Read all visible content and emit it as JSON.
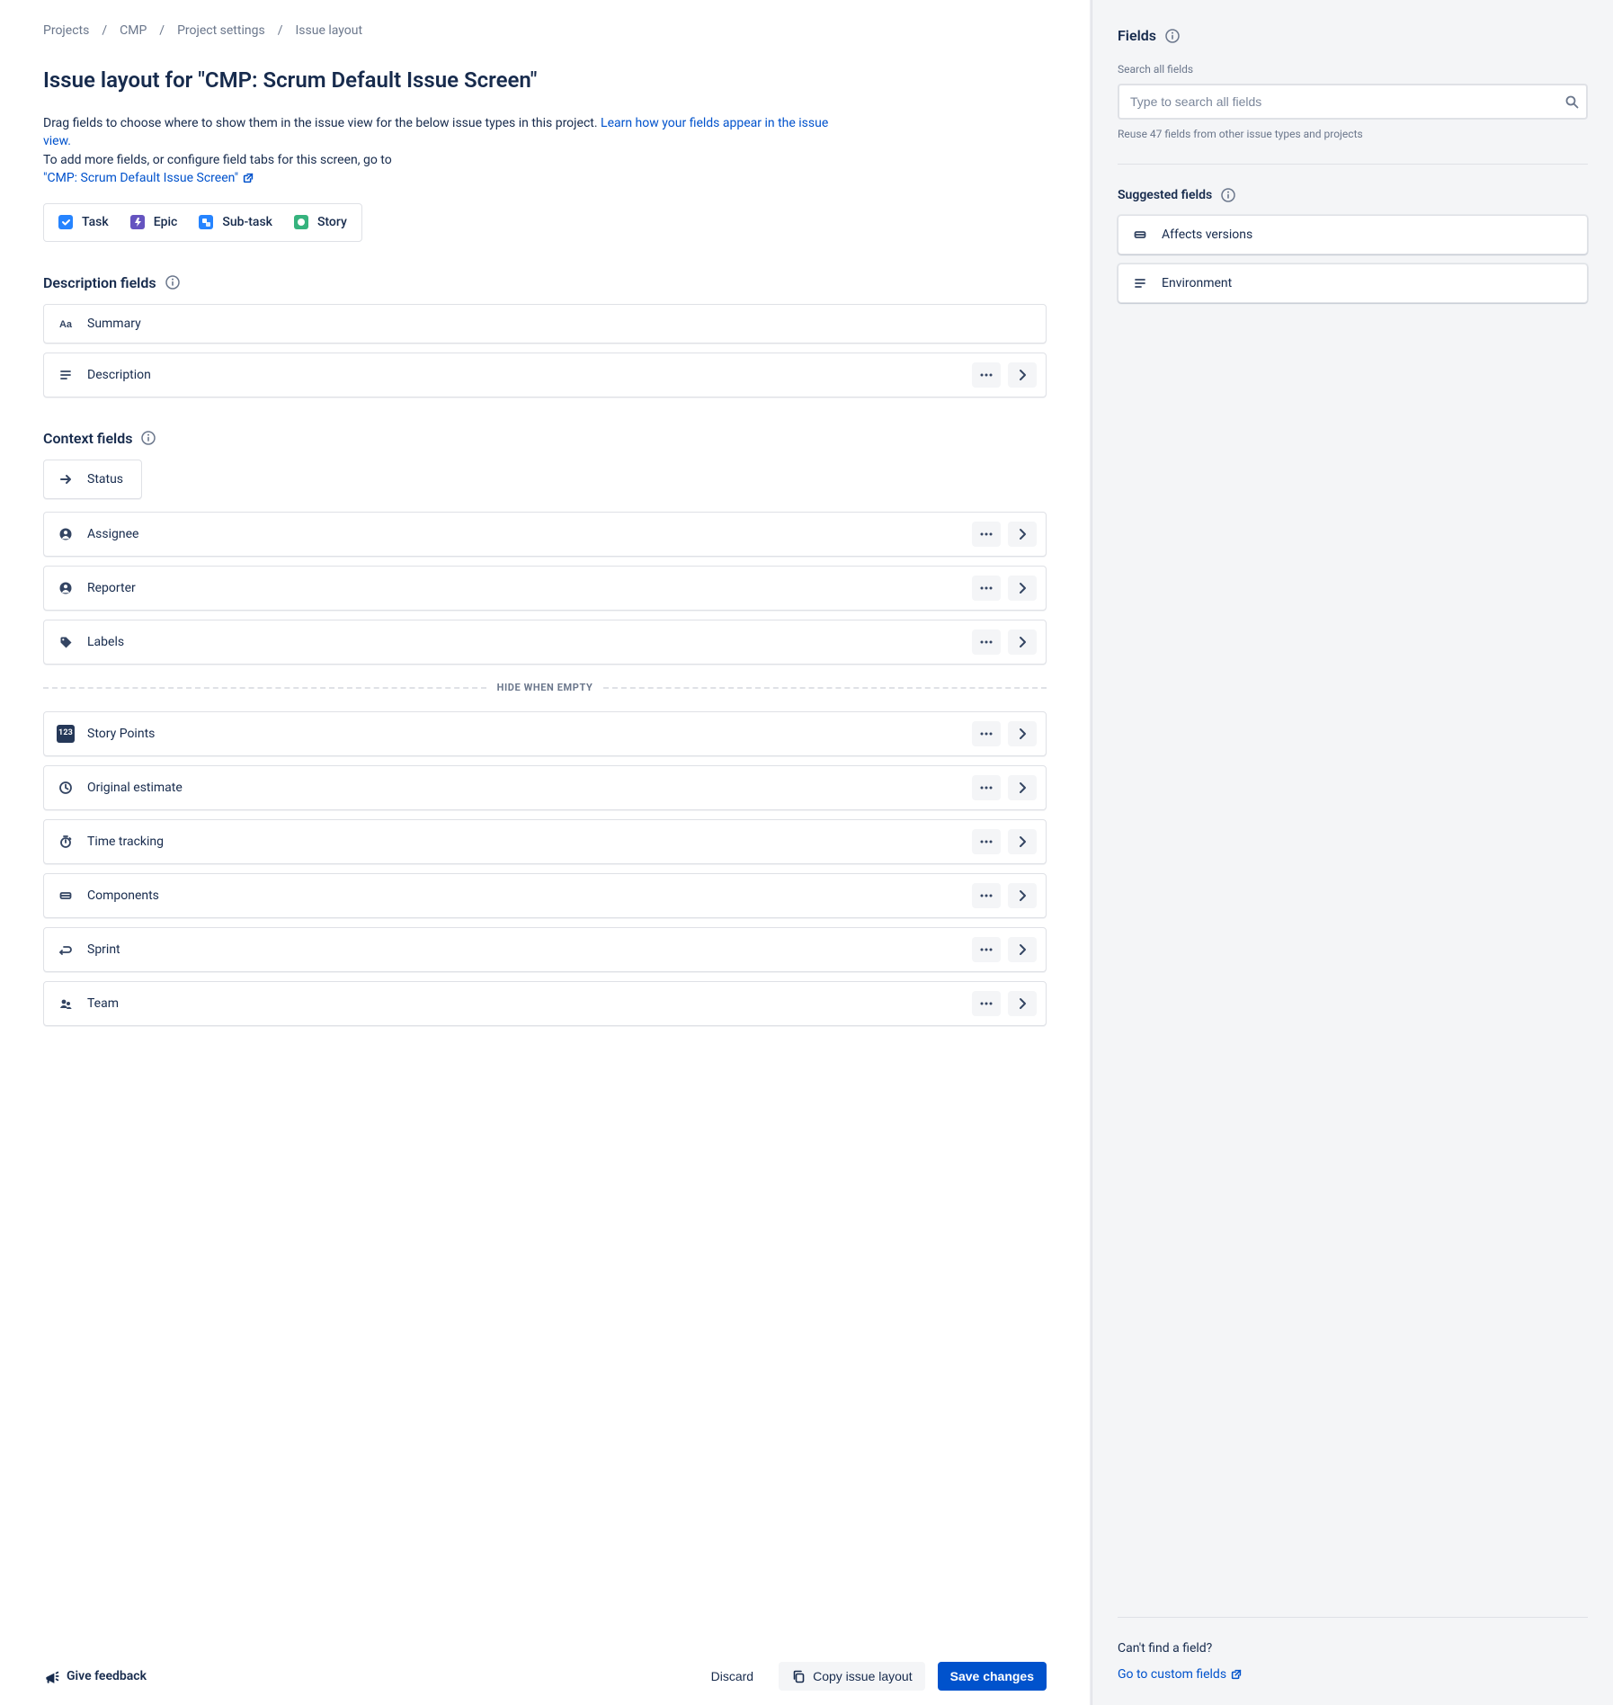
{
  "breadcrumb": [
    {
      "label": "Projects"
    },
    {
      "label": "CMP"
    },
    {
      "label": "Project settings"
    },
    {
      "label": "Issue layout"
    }
  ],
  "page_title": "Issue layout for \"CMP: Scrum Default Issue Screen\"",
  "intro_text_1": "Drag fields to choose where to show them in the issue view for the below issue types in this project.",
  "intro_link_1": "Learn how your fields appear in the issue view.",
  "intro_text_2": "To add more fields, or configure field tabs for this screen, go to",
  "intro_link_2": "\"CMP: Scrum Default Issue Screen\"",
  "issue_types": [
    {
      "label": "Task",
      "icon": "task"
    },
    {
      "label": "Epic",
      "icon": "epic"
    },
    {
      "label": "Sub-task",
      "icon": "subtask"
    },
    {
      "label": "Story",
      "icon": "story"
    }
  ],
  "sections": {
    "description": {
      "heading": "Description fields",
      "fields": [
        {
          "label": "Summary",
          "icon": "text",
          "actions": false
        },
        {
          "label": "Description",
          "icon": "paragraph",
          "actions": true
        }
      ]
    },
    "context": {
      "heading": "Context fields",
      "status_label": "Status",
      "fields_top": [
        {
          "label": "Assignee",
          "icon": "person"
        },
        {
          "label": "Reporter",
          "icon": "person"
        },
        {
          "label": "Labels",
          "icon": "tag"
        }
      ],
      "divider_label": "HIDE WHEN EMPTY",
      "fields_hidden": [
        {
          "label": "Story Points",
          "icon": "number"
        },
        {
          "label": "Original estimate",
          "icon": "clock"
        },
        {
          "label": "Time tracking",
          "icon": "stopwatch"
        },
        {
          "label": "Components",
          "icon": "component"
        },
        {
          "label": "Sprint",
          "icon": "sprint"
        },
        {
          "label": "Team",
          "icon": "team"
        }
      ]
    }
  },
  "footer": {
    "feedback": "Give feedback",
    "discard": "Discard",
    "copy": "Copy issue layout",
    "save": "Save changes"
  },
  "aside": {
    "heading": "Fields",
    "search_label": "Search all fields",
    "search_placeholder": "Type to search all fields",
    "reuse_note": "Reuse 47 fields from other issue types and projects",
    "suggested_heading": "Suggested fields",
    "suggested_fields": [
      {
        "label": "Affects versions",
        "icon": "component"
      },
      {
        "label": "Environment",
        "icon": "paragraph"
      }
    ],
    "not_found": "Can't find a field?",
    "custom_link": "Go to custom fields"
  }
}
